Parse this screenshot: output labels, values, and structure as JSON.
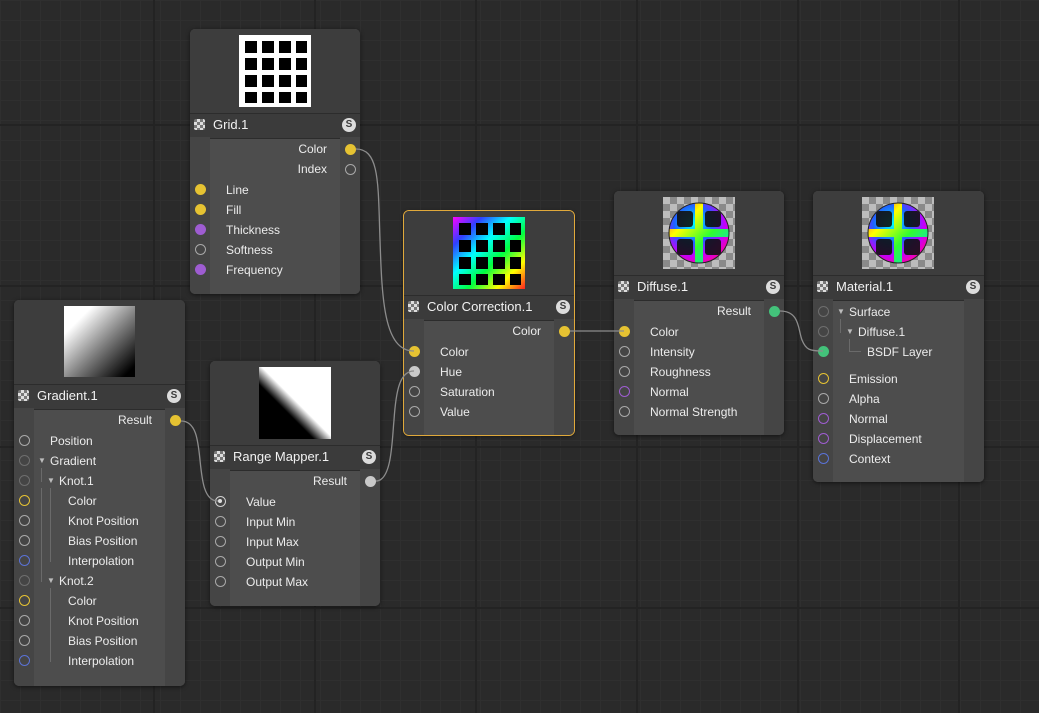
{
  "colors": {
    "port_yellow": "#e5c232",
    "port_grey": "#a8a8a8",
    "port_purple": "#9e5cd1",
    "port_blue": "#5a72d6",
    "port_green": "#43c27a",
    "selected_outline": "#e0a93b"
  },
  "nodes": {
    "grid": {
      "title": "Grid.1",
      "s_label": "S",
      "outputs": [
        "Color",
        "Index"
      ],
      "inputs": [
        "Line",
        "Fill",
        "Thickness",
        "Softness",
        "Frequency"
      ]
    },
    "gradient": {
      "title": "Gradient.1",
      "s_label": "S",
      "outputs": [
        "Result"
      ],
      "inputs": [
        "Position",
        "Gradient",
        "Knot.1",
        "Color",
        "Knot Position",
        "Bias Position",
        "Interpolation",
        "Knot.2",
        "Color",
        "Knot Position",
        "Bias Position",
        "Interpolation"
      ]
    },
    "range_mapper": {
      "title": "Range Mapper.1",
      "s_label": "S",
      "outputs": [
        "Result"
      ],
      "inputs": [
        "Value",
        "Input Min",
        "Input Max",
        "Output Min",
        "Output Max"
      ]
    },
    "color_correction": {
      "title": "Color Correction.1",
      "s_label": "S",
      "outputs": [
        "Color"
      ],
      "inputs": [
        "Color",
        "Hue",
        "Saturation",
        "Value"
      ]
    },
    "diffuse": {
      "title": "Diffuse.1",
      "s_label": "S",
      "outputs": [
        "Result"
      ],
      "inputs": [
        "Color",
        "Intensity",
        "Roughness",
        "Normal",
        "Normal Strength"
      ]
    },
    "material": {
      "title": "Material.1",
      "s_label": "S",
      "inputs": [
        "Surface",
        "Diffuse.1",
        "BSDF Layer",
        "Emission",
        "Alpha",
        "Normal",
        "Displacement",
        "Context"
      ]
    }
  }
}
